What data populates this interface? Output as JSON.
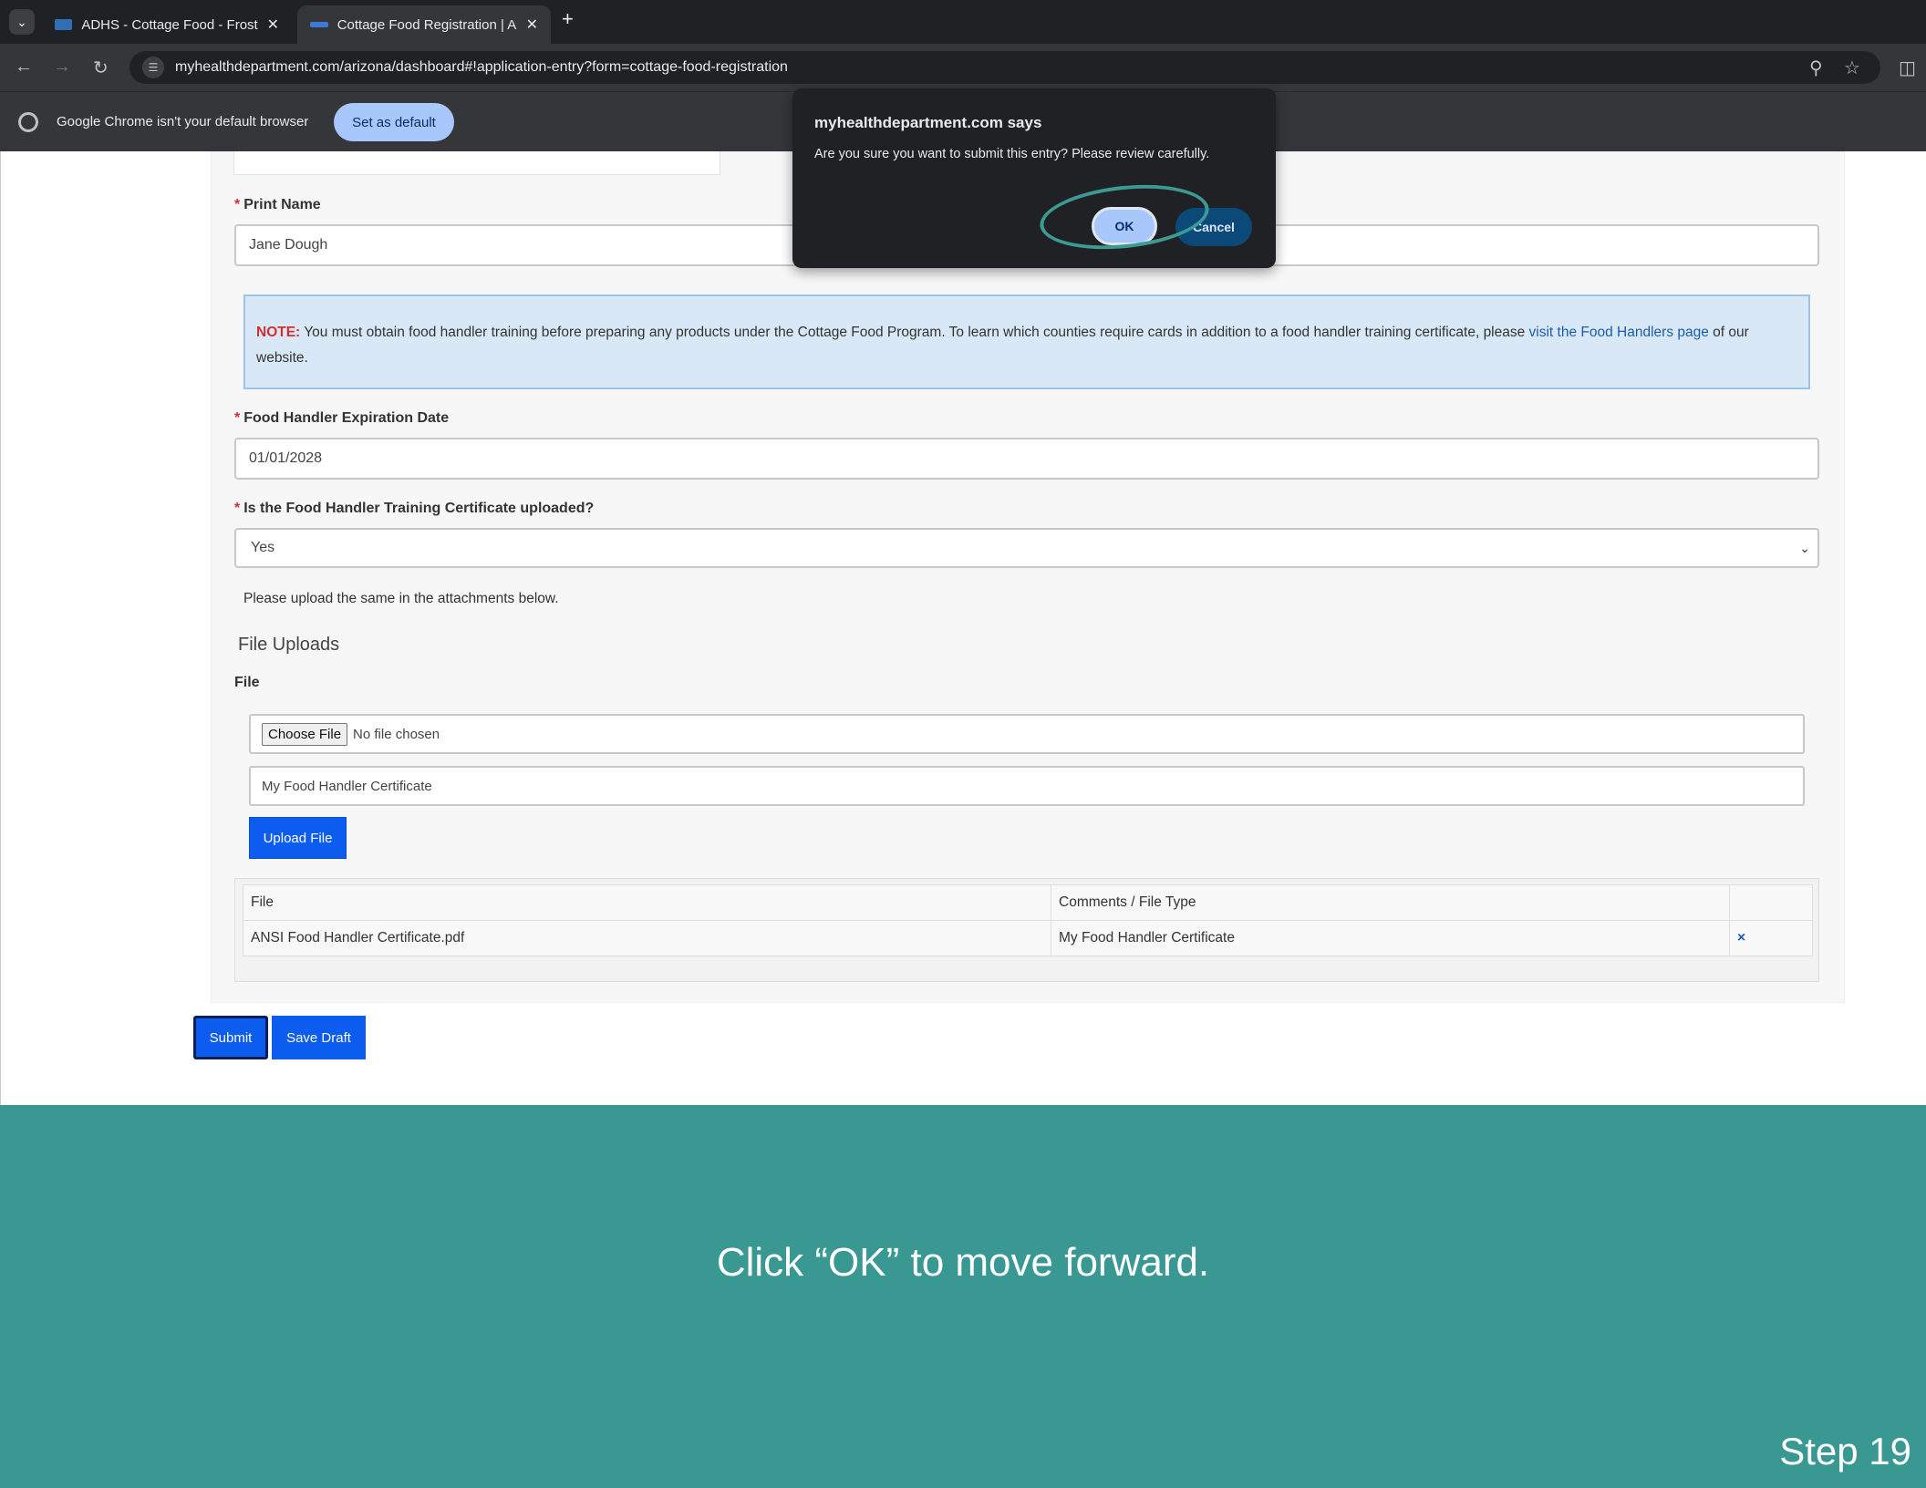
{
  "browser": {
    "tabs": [
      {
        "title": "ADHS - Cottage Food - Frosting",
        "favicon_color": "#2f6fb3",
        "close": "✕"
      },
      {
        "title": "Cottage Food Registration | Ari",
        "favicon_color": "#3b7bd8",
        "close": "✕"
      }
    ],
    "new_tab": "+",
    "tab_menu": "⌄",
    "url": "myhealthdepartment.com/arizona/dashboard#!application-entry?form=cottage-food-registration",
    "infobar": {
      "message": "Google Chrome isn't your default browser",
      "button": "Set as default"
    }
  },
  "form": {
    "print_name": {
      "label": "Print Name",
      "value": "Jane Dough",
      "required": "*"
    },
    "note": {
      "label": "NOTE:",
      "text": " You must obtain food handler training before preparing any products under the Cottage Food Program. To learn which counties require cards in addition to a food handler training certificate, please ",
      "link": "visit the Food Handlers page",
      "tail": " of our website."
    },
    "expiration": {
      "label": "Food Handler Expiration Date",
      "value": "01/01/2028",
      "required": "*"
    },
    "cert_uploaded": {
      "label": "Is the Food Handler Training Certificate uploaded?",
      "value": "Yes",
      "required": "*"
    },
    "help_text": "Please upload the same in the attachments below.",
    "uploads": {
      "heading": "File Uploads",
      "file_label": "File",
      "choose_button": "Choose File",
      "no_file": "No file chosen",
      "comment_value": "My Food Handler Certificate",
      "upload_button": "Upload File",
      "table": {
        "headers": [
          "File",
          "Comments / File Type",
          ""
        ],
        "rows": [
          {
            "file": "ANSI Food Handler Certificate.pdf",
            "comment": "My Food Handler Certificate",
            "remove": "×"
          }
        ]
      }
    },
    "submit": "Submit",
    "save_draft": "Save Draft"
  },
  "dialog": {
    "title": "myhealthdepartment.com says",
    "message": "Are you sure you want to submit this entry?  Please review carefully.",
    "ok": "OK",
    "cancel": "Cancel"
  },
  "caption": "Click “OK” to move forward.",
  "step": "Step 19",
  "colors": {
    "band": "#3a9892",
    "primary_button": "#0d5cf0",
    "highlight": "#3c9a92"
  }
}
